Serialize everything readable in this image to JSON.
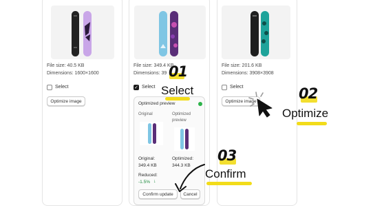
{
  "cards": [
    {
      "file_size": "File size: 40.5 KB",
      "dimensions": "Dimensions: 1600×1600",
      "select_label": "Select",
      "optimize_label": "Optimize image",
      "selected": false
    },
    {
      "file_size": "File size: 349.4 KB",
      "dimensions": "Dimensions: 39",
      "select_label": "Select",
      "selected": true
    },
    {
      "file_size": "File size: 201.6 KB",
      "dimensions": "Dimensions: 3908×3908",
      "select_label": "Select",
      "optimize_label": "Optimize image",
      "selected": false
    }
  ],
  "preview_panel": {
    "title": "Optimized preview",
    "status_color": "#2db34a",
    "original_label": "Original",
    "optimized_label_line1": "Optimized",
    "optimized_label_line2": "preview",
    "original_size_label": "Original:",
    "original_size_value": "349.4 KB",
    "optimized_size_label": "Optimized:",
    "optimized_size_value": "344.3 KB",
    "reduced_label": "Reduced:",
    "reduced_value": "-1.5%",
    "reduced_color": "#1a8a3c",
    "confirm_label": "Confirm update",
    "cancel_label": "Cancel"
  },
  "steps": [
    {
      "number": "01",
      "label": "Select"
    },
    {
      "number": "02",
      "label": "Optimize"
    },
    {
      "number": "03",
      "label": "Confirm"
    }
  ],
  "accent_color": "#f2dc1a"
}
